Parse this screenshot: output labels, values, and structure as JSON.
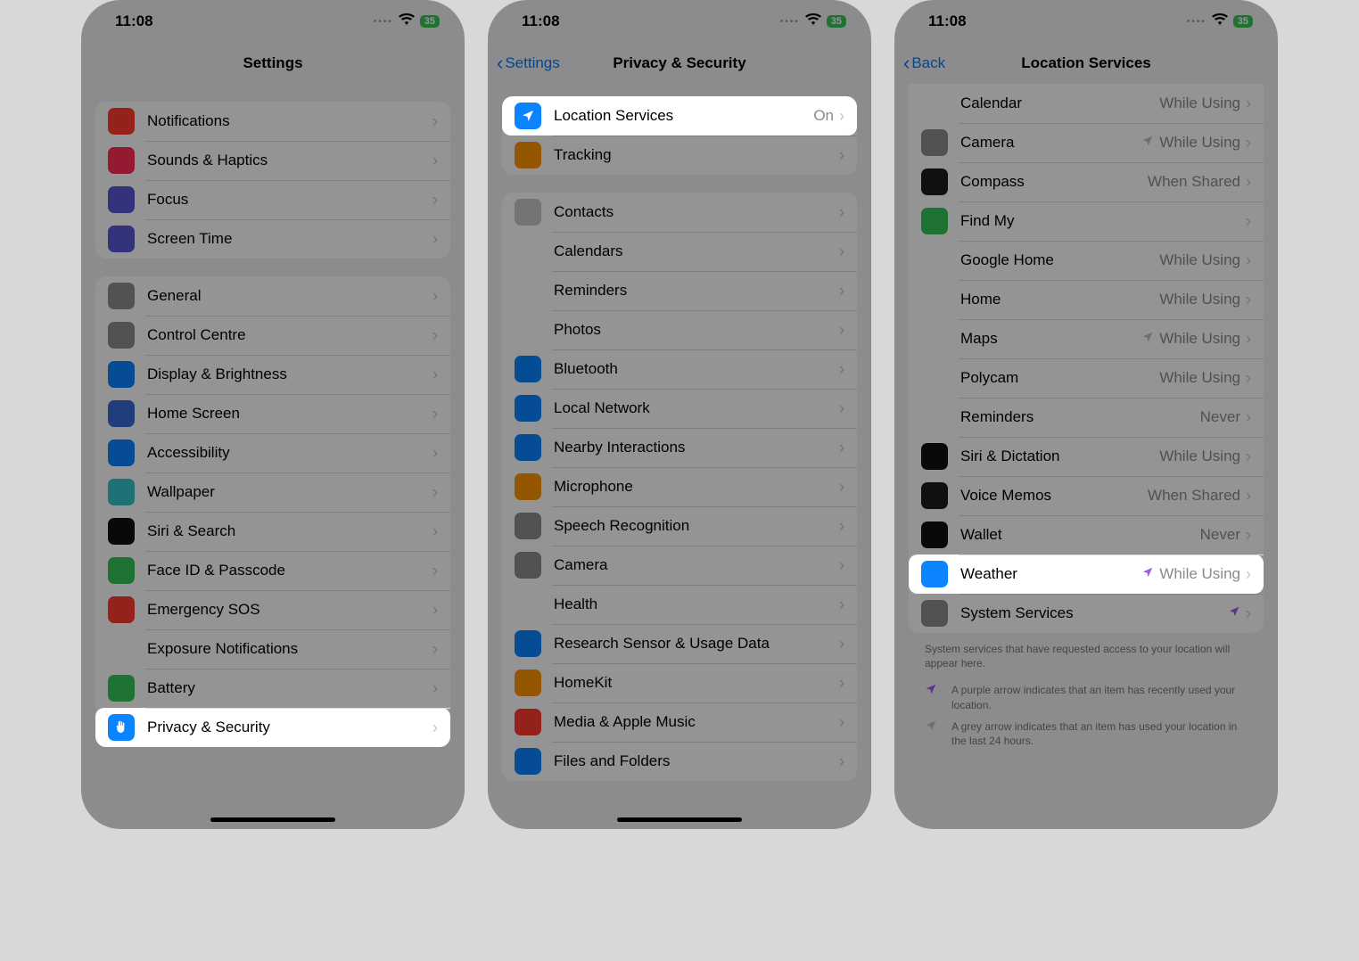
{
  "status": {
    "time": "11:08",
    "battery": "35"
  },
  "phone1": {
    "title": "Settings",
    "group1": [
      {
        "icon": "bell",
        "bg": "#ff3b30",
        "label": "Notifications"
      },
      {
        "icon": "speaker",
        "bg": "#ff2d55",
        "label": "Sounds & Haptics"
      },
      {
        "icon": "moon",
        "bg": "#5856d6",
        "label": "Focus"
      },
      {
        "icon": "hourglass",
        "bg": "#5856d6",
        "label": "Screen Time"
      }
    ],
    "group2": [
      {
        "icon": "gear",
        "bg": "#8e8e93",
        "label": "General"
      },
      {
        "icon": "sliders",
        "bg": "#8e8e93",
        "label": "Control Centre"
      },
      {
        "icon": "aa",
        "bg": "#0a84ff",
        "label": "Display & Brightness"
      },
      {
        "icon": "grid",
        "bg": "#3a6bd6",
        "label": "Home Screen"
      },
      {
        "icon": "person",
        "bg": "#0a84ff",
        "label": "Accessibility"
      },
      {
        "icon": "flower",
        "bg": "#35c3c9",
        "label": "Wallpaper"
      },
      {
        "icon": "siri",
        "bg": "#111",
        "label": "Siri & Search"
      },
      {
        "icon": "face",
        "bg": "#34c759",
        "label": "Face ID & Passcode"
      },
      {
        "icon": "sos",
        "bg": "#ff3b30",
        "label": "Emergency SOS"
      },
      {
        "icon": "virus",
        "bg": "#fff",
        "label": "Exposure Notifications"
      },
      {
        "icon": "battery",
        "bg": "#34c759",
        "label": "Battery"
      },
      {
        "icon": "hand",
        "bg": "#0a84ff",
        "label": "Privacy & Security",
        "highlight": true
      }
    ]
  },
  "phone2": {
    "back": "Settings",
    "title": "Privacy & Security",
    "group1": [
      {
        "icon": "location",
        "bg": "#0a84ff",
        "label": "Location Services",
        "value": "On",
        "highlight": true
      },
      {
        "icon": "tracking",
        "bg": "#ff9500",
        "label": "Tracking"
      }
    ],
    "group2": [
      {
        "icon": "contacts",
        "bg": "#c9c9ce",
        "label": "Contacts"
      },
      {
        "icon": "calendar",
        "bg": "#ffffff",
        "label": "Calendars"
      },
      {
        "icon": "reminders",
        "bg": "#ffffff",
        "label": "Reminders"
      },
      {
        "icon": "photos",
        "bg": "#ffffff",
        "label": "Photos"
      },
      {
        "icon": "bluetooth",
        "bg": "#0a84ff",
        "label": "Bluetooth"
      },
      {
        "icon": "globe",
        "bg": "#0a84ff",
        "label": "Local Network"
      },
      {
        "icon": "nearby",
        "bg": "#0a84ff",
        "label": "Nearby Interactions"
      },
      {
        "icon": "mic",
        "bg": "#ff9500",
        "label": "Microphone"
      },
      {
        "icon": "speech",
        "bg": "#8e8e93",
        "label": "Speech Recognition"
      },
      {
        "icon": "camera",
        "bg": "#8e8e93",
        "label": "Camera"
      },
      {
        "icon": "health",
        "bg": "#ffffff",
        "label": "Health"
      },
      {
        "icon": "research",
        "bg": "#0a84ff",
        "label": "Research Sensor & Usage Data"
      },
      {
        "icon": "homekit",
        "bg": "#ff9500",
        "label": "HomeKit"
      },
      {
        "icon": "music",
        "bg": "#ff3b30",
        "label": "Media & Apple Music"
      },
      {
        "icon": "files",
        "bg": "#0a84ff",
        "label": "Files and Folders"
      }
    ]
  },
  "phone3": {
    "back": "Back",
    "title": "Location Services",
    "apps": [
      {
        "label": "Calendar",
        "value": "While Using",
        "bg": "#ffffff"
      },
      {
        "label": "Camera",
        "value": "While Using",
        "bg": "#8e8e93",
        "arrow": "grey"
      },
      {
        "label": "Compass",
        "value": "When Shared",
        "bg": "#1c1c1e"
      },
      {
        "label": "Find My",
        "value": "",
        "bg": "#34c759"
      },
      {
        "label": "Google Home",
        "value": "While Using",
        "bg": "#ffffff"
      },
      {
        "label": "Home",
        "value": "While Using",
        "bg": "#fff"
      },
      {
        "label": "Maps",
        "value": "While Using",
        "bg": "#fff",
        "arrow": "grey"
      },
      {
        "label": "Polycam",
        "value": "While Using",
        "bg": "#fff"
      },
      {
        "label": "Reminders",
        "value": "Never",
        "bg": "#fff"
      },
      {
        "label": "Siri & Dictation",
        "value": "While Using",
        "bg": "#111"
      },
      {
        "label": "Voice Memos",
        "value": "When Shared",
        "bg": "#1c1c1e"
      },
      {
        "label": "Wallet",
        "value": "Never",
        "bg": "#111"
      },
      {
        "label": "Weather",
        "value": "While Using",
        "bg": "#0a84ff",
        "arrow": "purple",
        "highlight": true
      },
      {
        "label": "System Services",
        "value": "",
        "bg": "#8e8e93",
        "arrow": "purple"
      }
    ],
    "footnote": "System services that have requested access to your location will appear here.",
    "legend_purple": "A purple arrow indicates that an item has recently used your location.",
    "legend_grey": "A grey arrow indicates that an item has used your location in the last 24 hours."
  }
}
